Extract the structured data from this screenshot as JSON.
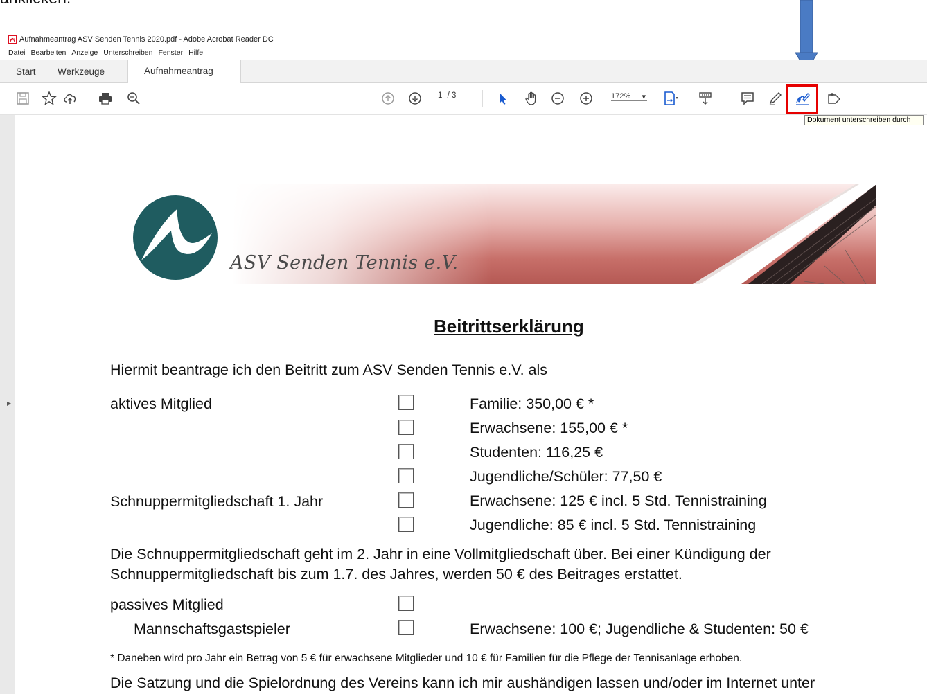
{
  "caption": "anklicken.",
  "window": {
    "title": "Aufnahmeantrag ASV Senden Tennis 2020.pdf - Adobe Acrobat Reader DC",
    "menu": [
      "Datei",
      "Bearbeiten",
      "Anzeige",
      "Unterschreiben",
      "Fenster",
      "Hilfe"
    ]
  },
  "tabs": {
    "start": "Start",
    "tools": "Werkzeuge",
    "document": "Aufnahmeantrag A...",
    "close": "×"
  },
  "toolbar": {
    "page_current": "1",
    "page_total": "/ 3",
    "zoom": "172%",
    "zoom_caret": "▾",
    "tooltip": "Dokument unterschreiben durch"
  },
  "colors": {
    "arrow": "#4a7bc4",
    "highlight": "#e60000",
    "logo": "#1f5c60"
  },
  "banner": {
    "club_name": "ASV Senden Tennis e.V."
  },
  "document": {
    "heading": "Beitrittserklärung",
    "intro": "Hiermit beantrage ich den Beitritt  zum ASV Senden Tennis e.V. als",
    "active_label": "aktives Mitglied",
    "active_options": [
      "Familie: 350,00 € *",
      "Erwachsene: 155,00 € *",
      "Studenten: 116,25 €",
      "Jugendliche/Schüler: 77,50 €"
    ],
    "trial_label": "Schnuppermitgliedschaft 1. Jahr",
    "trial_options": [
      "Erwachsene: 125 € incl. 5 Std. Tennistraining",
      "Jugendliche: 85 € incl. 5 Std. Tennistraining"
    ],
    "trial_note_1": "Die Schnuppermitgliedschaft geht im 2. Jahr in eine Vollmitgliedschaft über. Bei einer Kündigung der",
    "trial_note_2": "Schnuppermitgliedschaft bis zum 1.7. des Jahres, werden 50 € des Beitrages erstattet.",
    "passive_label": "passives Mitglied",
    "guest_label": "Mannschaftsgastspieler",
    "guest_option": "Erwachsene: 100 €; Jugendliche & Studenten: 50 €",
    "footnote": "* Daneben wird pro Jahr ein Betrag von 5 € für erwachsene Mitglieder und 10 € für Familien für die Pflege der Tennisanlage erhoben.",
    "statutes": "Die Satzung und die Spielordnung des Vereins kann ich mir aushändigen lassen und/oder im Internet unter"
  }
}
